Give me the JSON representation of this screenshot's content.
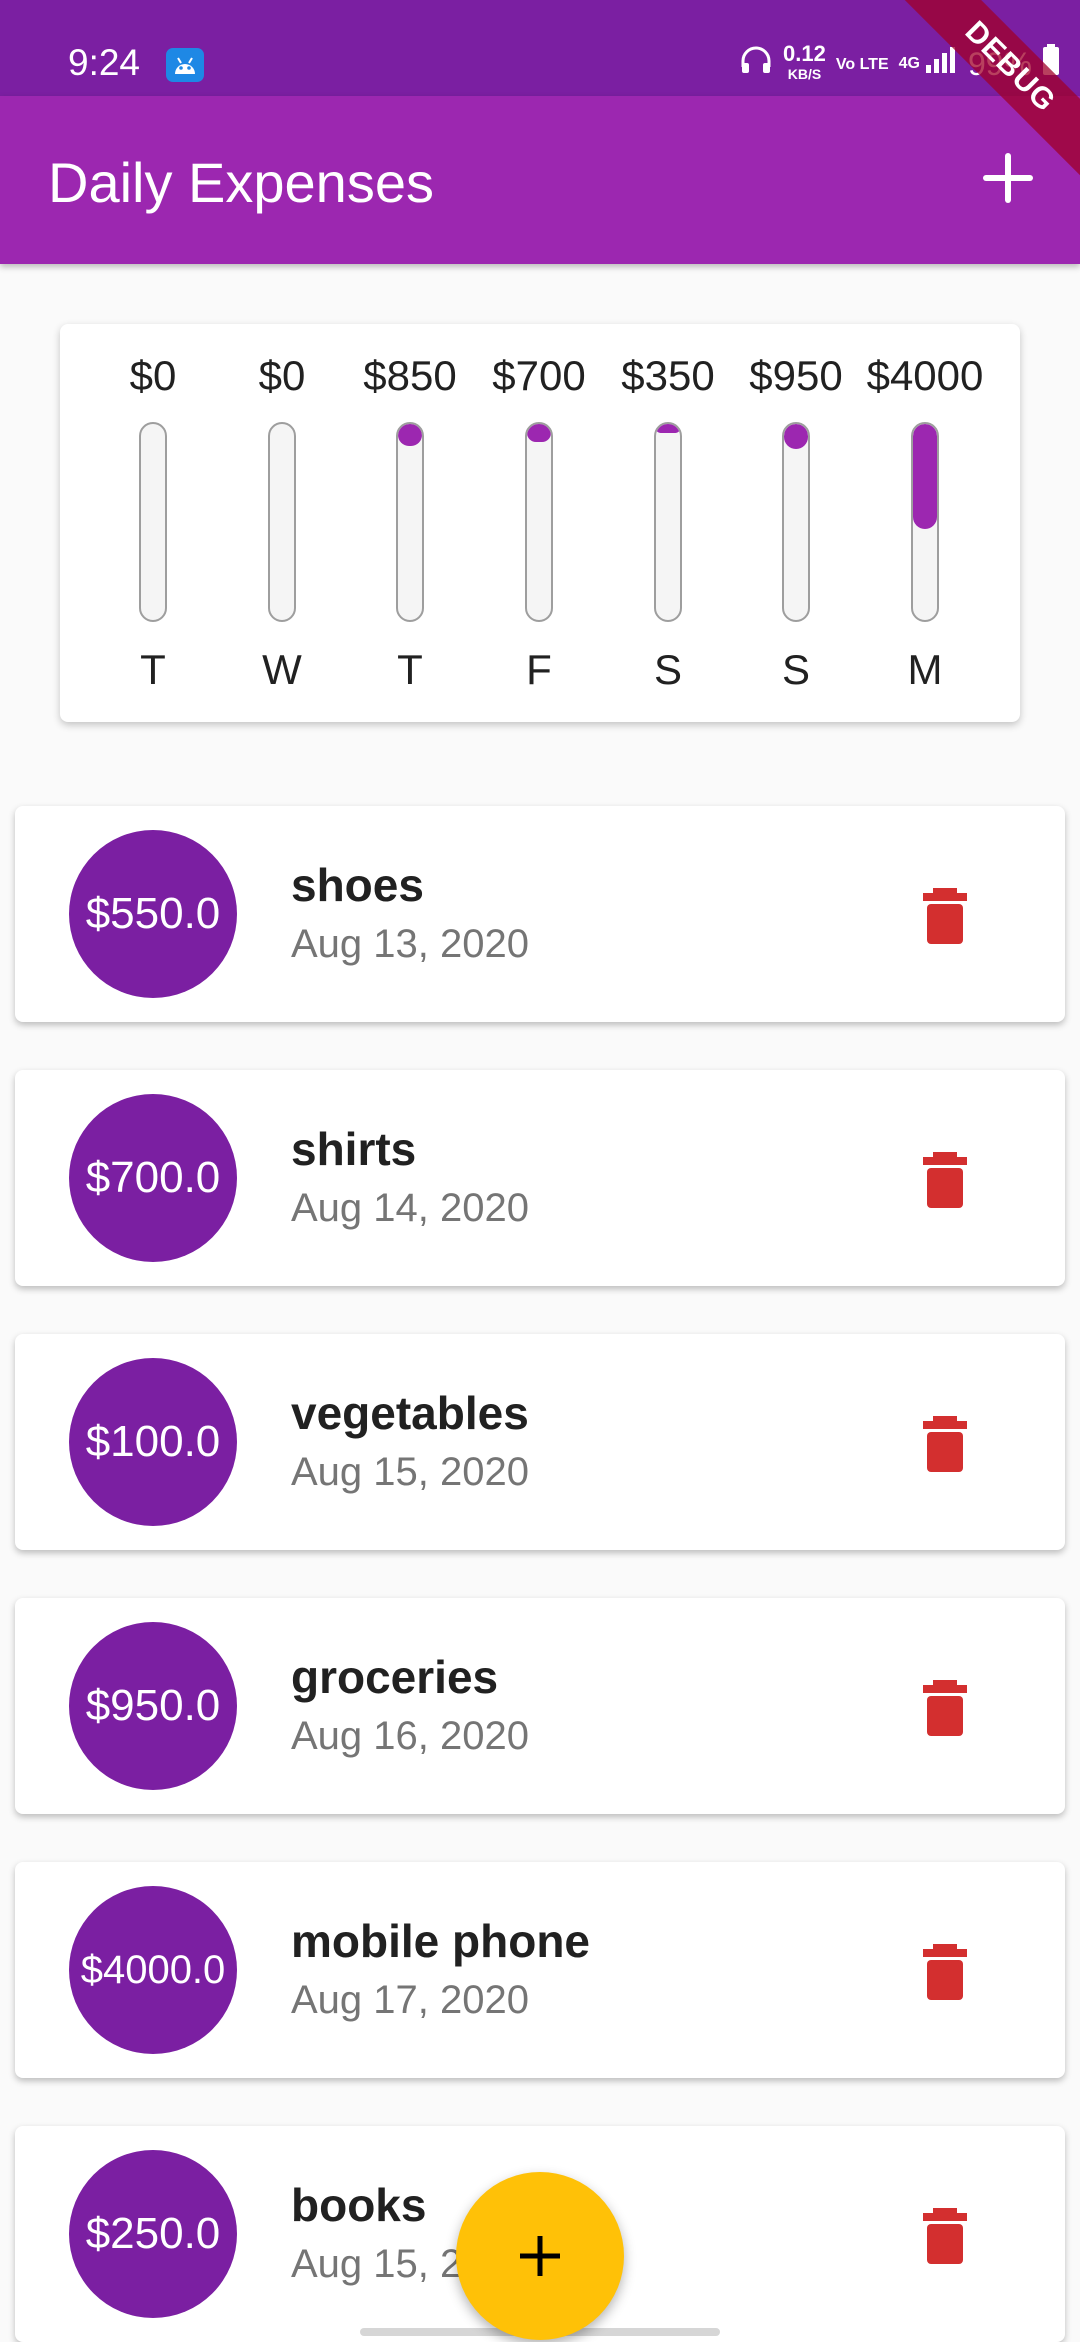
{
  "status_bar": {
    "time": "9:24",
    "net_speed": "0.12",
    "net_speed_unit": "KB/S",
    "volte": "Vo LTE",
    "network": "4G",
    "battery": "99%",
    "icons": [
      "android-notification-icon",
      "headphones-icon",
      "signal-icon",
      "battery-icon"
    ]
  },
  "debug_banner": "DEBUG",
  "app_bar": {
    "title": "Daily Expenses",
    "action_icon": "add-icon"
  },
  "chart": {
    "accent_color": "#9c27b0",
    "bars": [
      {
        "day": "T",
        "amount": "$0",
        "fraction": 0.0
      },
      {
        "day": "W",
        "amount": "$0",
        "fraction": 0.0
      },
      {
        "day": "T",
        "amount": "$850",
        "fraction": 0.1133
      },
      {
        "day": "F",
        "amount": "$700",
        "fraction": 0.0933
      },
      {
        "day": "S",
        "amount": "$350",
        "fraction": 0.0467
      },
      {
        "day": "S",
        "amount": "$950",
        "fraction": 0.1267
      },
      {
        "day": "M",
        "amount": "$4000",
        "fraction": 0.5333
      }
    ]
  },
  "transactions": [
    {
      "amount": "$550.0",
      "title": "shoes",
      "date": "Aug 13, 2020"
    },
    {
      "amount": "$700.0",
      "title": "shirts",
      "date": "Aug 14, 2020"
    },
    {
      "amount": "$100.0",
      "title": "vegetables",
      "date": "Aug 15, 2020"
    },
    {
      "amount": "$950.0",
      "title": "groceries",
      "date": "Aug 16, 2020"
    },
    {
      "amount": "$4000.0",
      "title": "mobile phone",
      "date": "Aug 17, 2020"
    },
    {
      "amount": "$250.0",
      "title": "books",
      "date": "Aug 15, 2020"
    }
  ],
  "colors": {
    "primary": "#9c27b0",
    "primary_dark": "#7b1fa2",
    "delete": "#d32f2f",
    "fab": "#ffc107"
  },
  "fab": {
    "icon": "add-icon"
  }
}
